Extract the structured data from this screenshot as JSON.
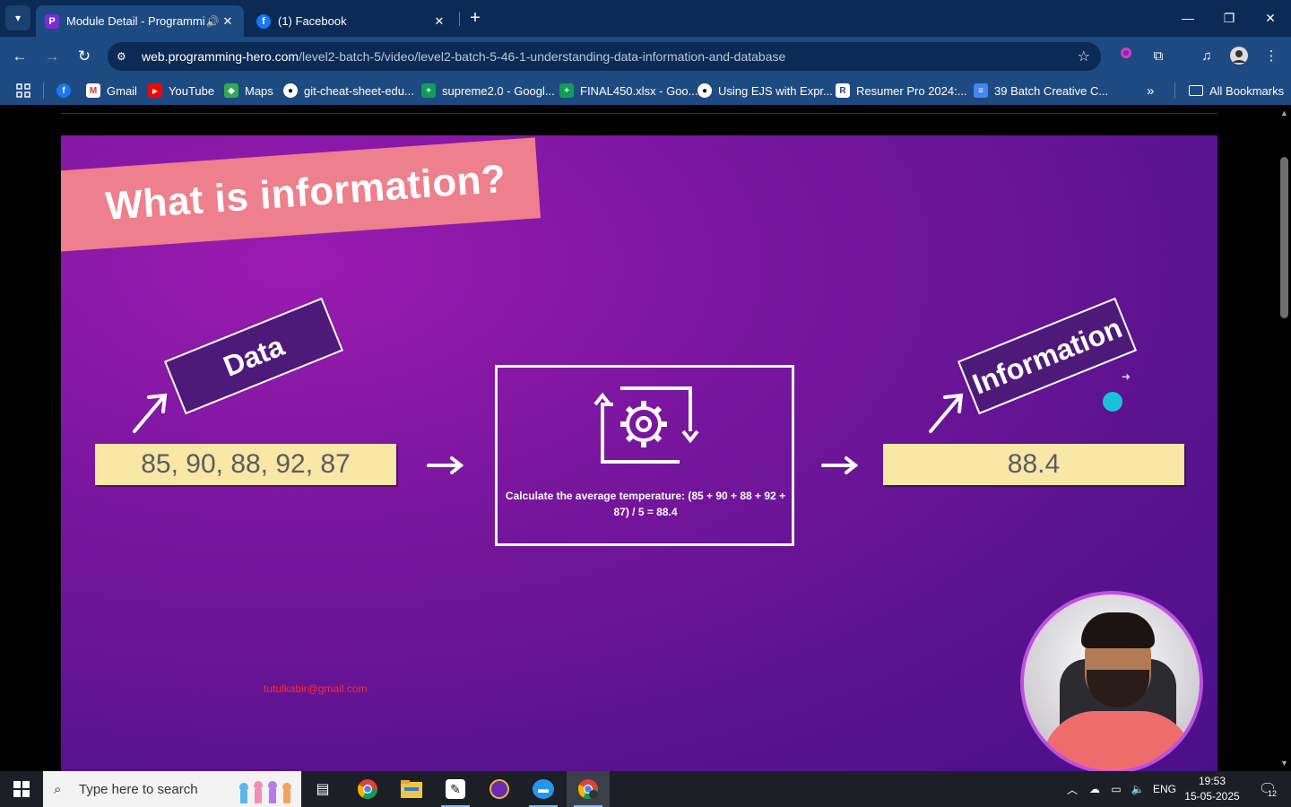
{
  "browser": {
    "tabs": [
      {
        "title": "Module Detail - Programming Hero",
        "active": true,
        "icon": "programming-hero-icon",
        "audio": true
      },
      {
        "title": "(1) Facebook",
        "active": false,
        "icon": "facebook-icon"
      }
    ],
    "url_host": "web.programming-hero.com",
    "url_path": "/level2-batch-5/video/level2-batch-5-46-1-understanding-data-information-and-database",
    "bookmarks": [
      {
        "label": "",
        "icon": "facebook-icon"
      },
      {
        "label": "Gmail",
        "icon": "gmail-icon"
      },
      {
        "label": "YouTube",
        "icon": "youtube-icon"
      },
      {
        "label": "Maps",
        "icon": "maps-icon"
      },
      {
        "label": "git-cheat-sheet-edu...",
        "icon": "github-icon"
      },
      {
        "label": "supreme2.0 - Googl...",
        "icon": "sheets-icon"
      },
      {
        "label": "FINAL450.xlsx - Goo...",
        "icon": "sheets-icon"
      },
      {
        "label": "Using EJS with Expr...",
        "icon": "github-icon"
      },
      {
        "label": "Resumer Pro 2024:...",
        "icon": "resumer-icon"
      },
      {
        "label": "39 Batch Creative C...",
        "icon": "docs-icon"
      }
    ],
    "all_bookmarks": "All Bookmarks",
    "more_chevron": "»"
  },
  "slide": {
    "title": "What is information?",
    "data_tag": "Data",
    "data_values": "85, 90, 88, 92, 87",
    "process_text": "Calculate the average temperature: (85 + 90 + 88 + 92 + 87) / 5 = 88.4",
    "information_tag": "Information",
    "information_value": "88.4",
    "watermark_email": "tutulkabir@gmail.com"
  },
  "taskbar": {
    "search_placeholder": "Type here to search",
    "language": "ENG",
    "time": "19:53",
    "date": "15-05-2025",
    "notification_count": "12"
  },
  "colors": {
    "tab_strip": "#0b2a55",
    "toolbar": "#1e4a82",
    "slide_purple": "#7a169f",
    "title_banner": "#ee7f8c",
    "value_box": "#f9e7a6",
    "email_red": "#ff2a2a"
  }
}
